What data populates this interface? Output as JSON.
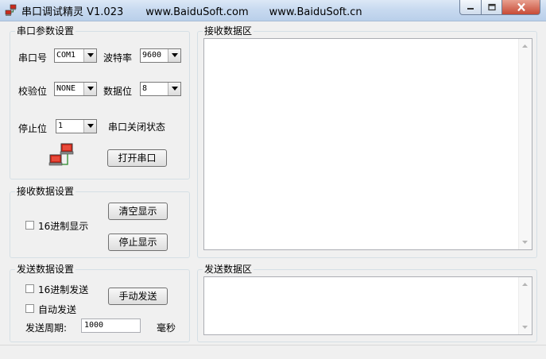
{
  "window": {
    "title": "串口调试精灵 V1.023",
    "site1": "www.BaiduSoft.com",
    "site2": "www.BaiduSoft.cn"
  },
  "serial_group": {
    "title": "串口参数设置",
    "port_label": "串口号",
    "port_value": "COM1",
    "baud_label": "波特率",
    "baud_value": "9600",
    "parity_label": "校验位",
    "parity_value": "NONE",
    "databits_label": "数据位",
    "databits_value": "8",
    "stopbits_label": "停止位",
    "stopbits_value": "1",
    "status_text": "串口关闭状态",
    "open_button": "打开串口"
  },
  "receive_settings": {
    "title": "接收数据设置",
    "hex_display_label": "16进制显示",
    "clear_button": "清空显示",
    "stop_button": "停止显示"
  },
  "send_settings": {
    "title": "发送数据设置",
    "hex_send_label": "16进制发送",
    "auto_send_label": "自动发送",
    "manual_send_button": "手动发送",
    "period_label": "发送周期:",
    "period_value": "1000",
    "period_unit": "毫秒"
  },
  "receive_area": {
    "title": "接收数据区"
  },
  "send_area": {
    "title": "发送数据区"
  }
}
